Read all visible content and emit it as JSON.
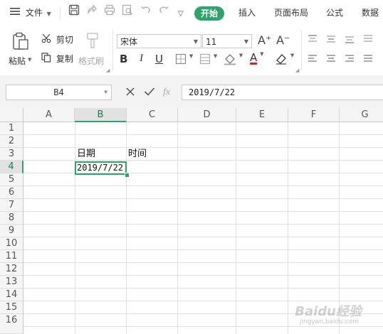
{
  "menubar": {
    "file_label": "文件",
    "tabs": [
      {
        "label": "开始",
        "active": true
      },
      {
        "label": "插入",
        "active": false
      },
      {
        "label": "页面布局",
        "active": false
      },
      {
        "label": "公式",
        "active": false
      },
      {
        "label": "数据",
        "active": false
      }
    ]
  },
  "ribbon": {
    "paste_label": "粘贴",
    "cut_label": "剪切",
    "copy_label": "复制",
    "format_painter_label": "格式刷",
    "font_name": "宋体",
    "font_size": "11",
    "bold_label": "B",
    "italic_label": "I",
    "underline_label": "U",
    "font_color_label": "A",
    "font_color": "#e02020",
    "grow_font_label": "A⁺",
    "shrink_font_label": "A⁻"
  },
  "formula_bar": {
    "name_box": "B4",
    "fx_label": "fx",
    "formula": "2019/7/22"
  },
  "sheet": {
    "columns": [
      "A",
      "B",
      "C",
      "D",
      "E",
      "F",
      "G"
    ],
    "rows": [
      "1",
      "2",
      "3",
      "4",
      "5",
      "6",
      "7",
      "8",
      "9",
      "10",
      "11",
      "12",
      "13",
      "14",
      "15",
      "16"
    ],
    "selected_column": "B",
    "selected_row": "4",
    "cells": {
      "B3": "日期",
      "C3": "时间",
      "B4": "2019/7/22"
    }
  },
  "watermark": {
    "text": "Baidu经验",
    "subtext": "jingyan.baidu.com"
  },
  "colors": {
    "accent": "#2ea36b"
  }
}
